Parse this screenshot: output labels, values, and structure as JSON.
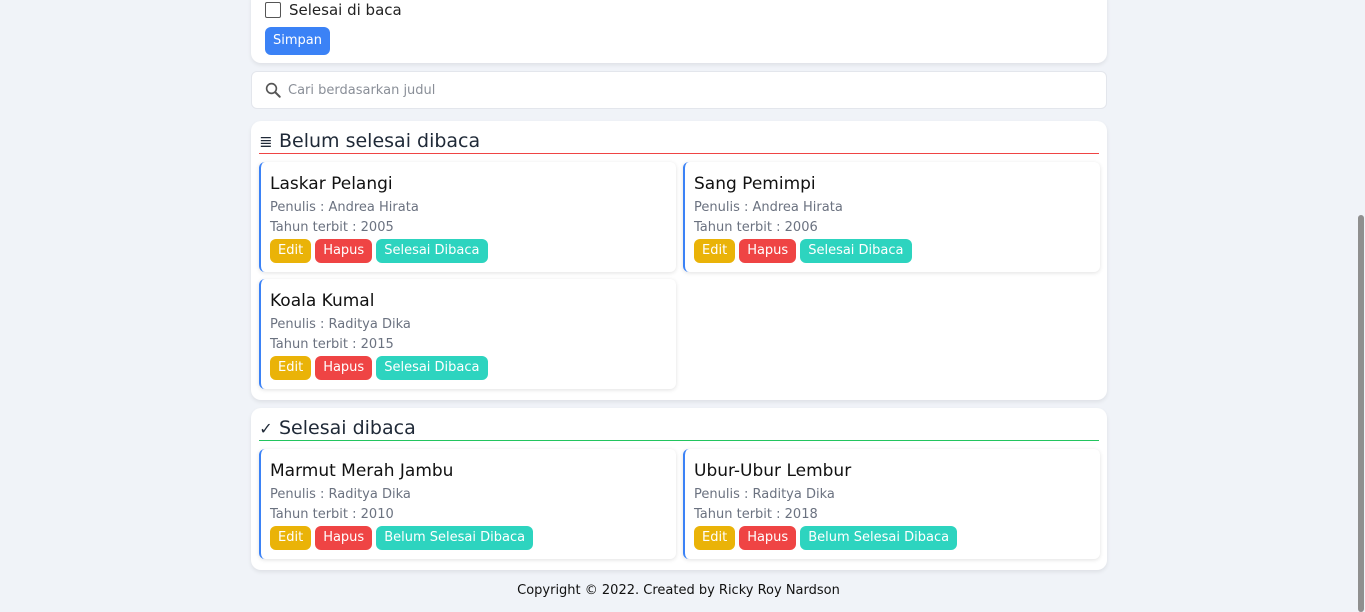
{
  "form": {
    "checkbox_label": "Selesai di baca",
    "save_label": "Simpan"
  },
  "search": {
    "placeholder": "Cari berdasarkan judul"
  },
  "unread": {
    "icon": "≣",
    "title": "Belum selesai dibaca",
    "line_color": "#ef4444",
    "books": [
      {
        "title": "Laskar Pelangi",
        "author": "Penulis : Andrea Hirata",
        "year": "Tahun terbit : 2005",
        "edit": "Edit",
        "hapus": "Hapus",
        "toggle": "Selesai Dibaca"
      },
      {
        "title": "Sang Pemimpi",
        "author": "Penulis : Andrea Hirata",
        "year": "Tahun terbit : 2006",
        "edit": "Edit",
        "hapus": "Hapus",
        "toggle": "Selesai Dibaca"
      },
      {
        "title": "Koala Kumal",
        "author": "Penulis : Raditya Dika",
        "year": "Tahun terbit : 2015",
        "edit": "Edit",
        "hapus": "Hapus",
        "toggle": "Selesai Dibaca"
      }
    ]
  },
  "read": {
    "icon": "✓",
    "title": "Selesai dibaca",
    "line_color": "#22c55e",
    "books": [
      {
        "title": "Marmut Merah Jambu",
        "author": "Penulis : Raditya Dika",
        "year": "Tahun terbit : 2010",
        "edit": "Edit",
        "hapus": "Hapus",
        "toggle": "Belum Selesai Dibaca"
      },
      {
        "title": "Ubur-Ubur Lembur",
        "author": "Penulis : Raditya Dika",
        "year": "Tahun terbit : 2018",
        "edit": "Edit",
        "hapus": "Hapus",
        "toggle": "Belum Selesai Dibaca"
      }
    ]
  },
  "footer": {
    "text": "Copyright © 2022. Created by Ricky Roy Nardson"
  }
}
